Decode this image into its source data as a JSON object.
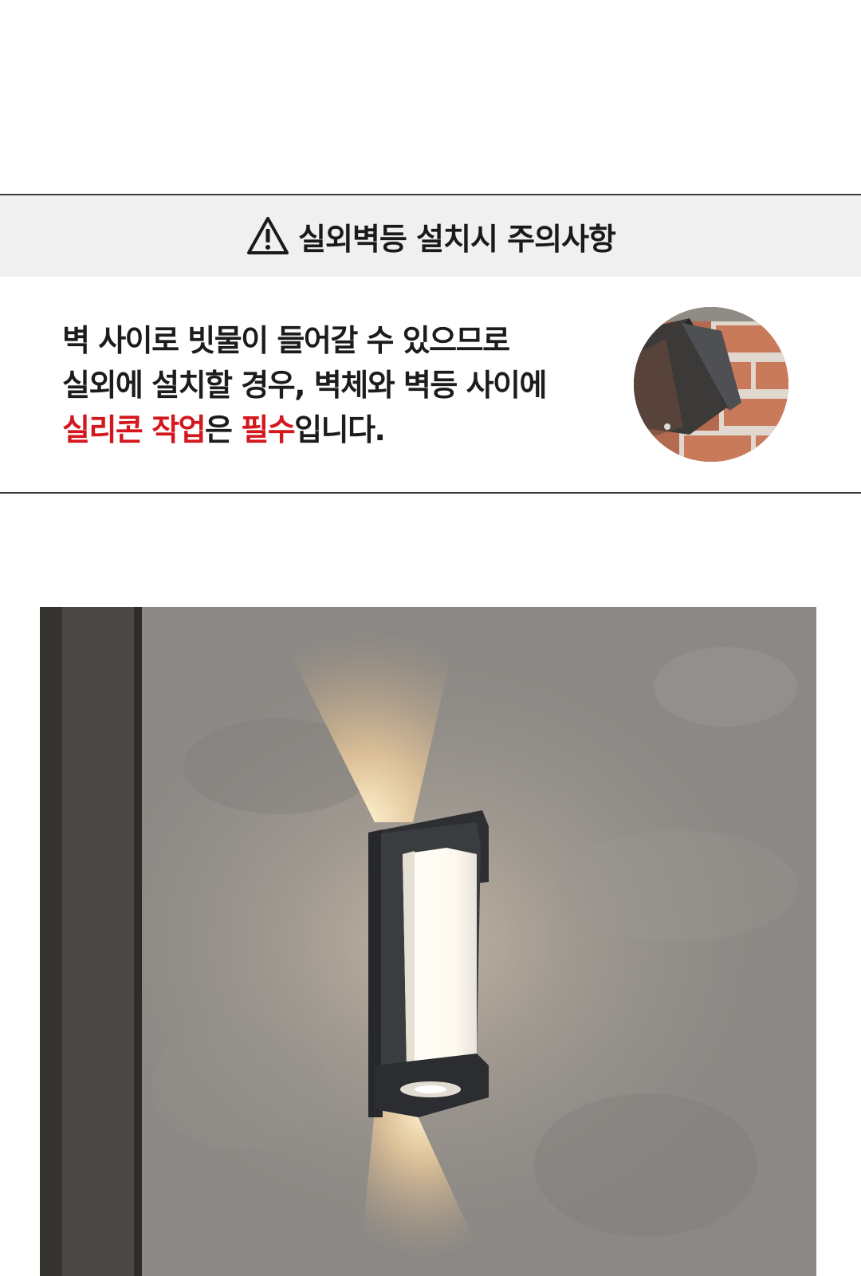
{
  "notice": {
    "icon": "warning-triangle-icon",
    "title": "실외벽등 설치시 주의사항",
    "lines": [
      "벽 사이로 빗물이 들어갈 수 있으므로",
      "실외에 설치할 경우, 벽체와 벽등 사이에"
    ],
    "line3": {
      "red1": "실리콘 작업",
      "plain1": "은 ",
      "red2": "필수",
      "plain2": "입니다."
    },
    "accent_color": "#d4161d"
  }
}
